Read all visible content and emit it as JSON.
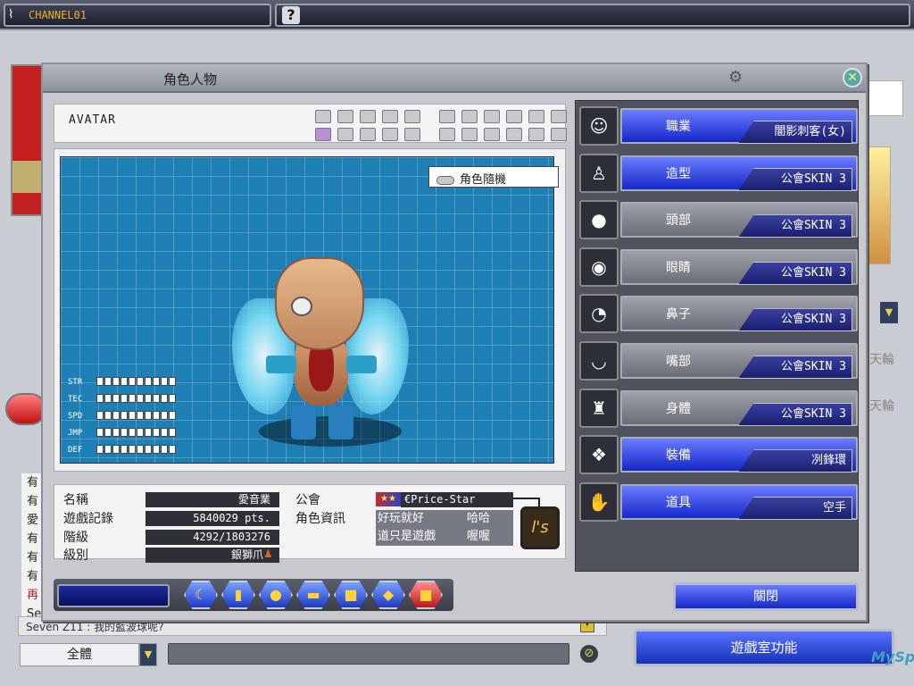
{
  "topbar": {
    "channel": "CHANNEL01",
    "help_icon": "?"
  },
  "background": {
    "chat_lines": [
      "有",
      "有",
      "愛",
      "有",
      "有",
      "有",
      "再",
      "Se"
    ],
    "chat_last": "Seven Z11 : 我的藍波球呢?",
    "channel_select": "全體",
    "room_function": "遊戲室功能",
    "logo": "MySpile",
    "wheel_labels": [
      "天輪",
      "天輪"
    ]
  },
  "modal": {
    "title": "角色人物",
    "avatar_label": "AVATAR",
    "slot_rows": [
      [
        false,
        false,
        false,
        false,
        false,
        false,
        false,
        false,
        false,
        false,
        false
      ],
      [
        true,
        false,
        false,
        false,
        false,
        false,
        false,
        false,
        false,
        false,
        false
      ]
    ],
    "random_label": "角色隨機",
    "stats": [
      {
        "label": "STR",
        "filled": 0,
        "max": 10
      },
      {
        "label": "TEC",
        "filled": 0,
        "max": 10
      },
      {
        "label": "SPD",
        "filled": 0,
        "max": 10
      },
      {
        "label": "JMP",
        "filled": 0,
        "max": 10
      },
      {
        "label": "DEF",
        "filled": 0,
        "max": 10
      }
    ],
    "info": {
      "name_label": "名稱",
      "name_value": "愛音業",
      "record_label": "遊戲記錄",
      "record_value": "5840029 pts.",
      "level_label": "階級",
      "level_value": "4292/1803276",
      "rank_label": "級別",
      "rank_value": "銀獅爪",
      "guild_label": "公會",
      "guild_info_label": "角色資訊",
      "guild_name": "€Price-Star",
      "guild_msg": [
        "好玩就好",
        "哈哈",
        "道只是遊戲",
        "喔喔"
      ],
      "emblem": "l's"
    },
    "toolbar_icons": [
      "moon-icon",
      "card-icon",
      "chat-icon",
      "folder-icon",
      "box-icon",
      "bag-icon",
      "flag-icon"
    ],
    "right_items": [
      {
        "label": "職業",
        "value": "闇影刺客(女)",
        "style": "blue",
        "icon": "portrait-icon"
      },
      {
        "label": "造型",
        "value": "公會SKIN 3",
        "style": "blue",
        "icon": "silhouette-icon"
      },
      {
        "label": "頭部",
        "value": "公會SKIN 3",
        "style": "gray",
        "icon": "head-icon"
      },
      {
        "label": "眼睛",
        "value": "公會SKIN 3",
        "style": "gray",
        "icon": "eyes-icon"
      },
      {
        "label": "鼻子",
        "value": "公會SKIN 3",
        "style": "gray",
        "icon": "nose-icon"
      },
      {
        "label": "嘴部",
        "value": "公會SKIN 3",
        "style": "gray",
        "icon": "mouth-icon"
      },
      {
        "label": "身體",
        "value": "公會SKIN 3",
        "style": "gray",
        "icon": "body-icon"
      },
      {
        "label": "裝備",
        "value": "冽鋒環",
        "style": "blue",
        "icon": "equipment-icon"
      },
      {
        "label": "道具",
        "value": "空手",
        "style": "blue",
        "icon": "hand-icon"
      }
    ],
    "close_label": "關閉"
  },
  "colors": {
    "accent_blue": "#1428c8",
    "grid_blue": "#1e7fb5",
    "title_gray": "#8d919c"
  }
}
